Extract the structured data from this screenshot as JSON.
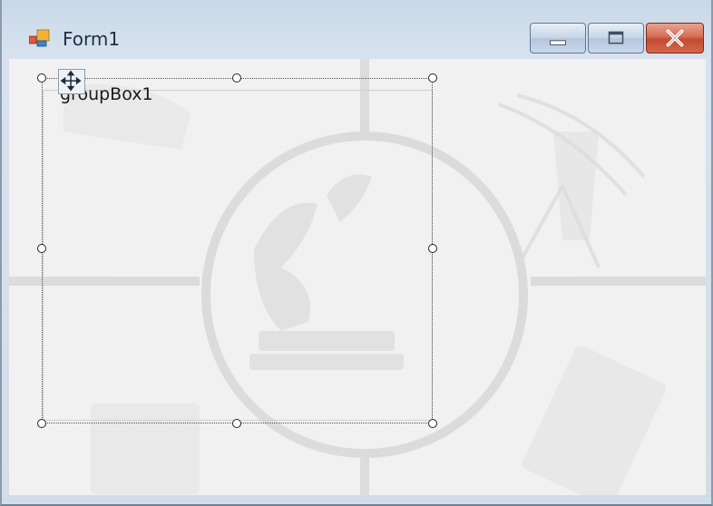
{
  "window": {
    "title": "Form1",
    "controls": {
      "minimize": "minimize-icon",
      "maximize": "maximize-icon",
      "close": "close-icon"
    },
    "colors": {
      "close_button": "#c9553a",
      "frame": "#c9d8e8"
    }
  },
  "designer": {
    "groupbox": {
      "label": "groupBox1"
    },
    "move_handle_icon": "move-arrows-icon"
  }
}
